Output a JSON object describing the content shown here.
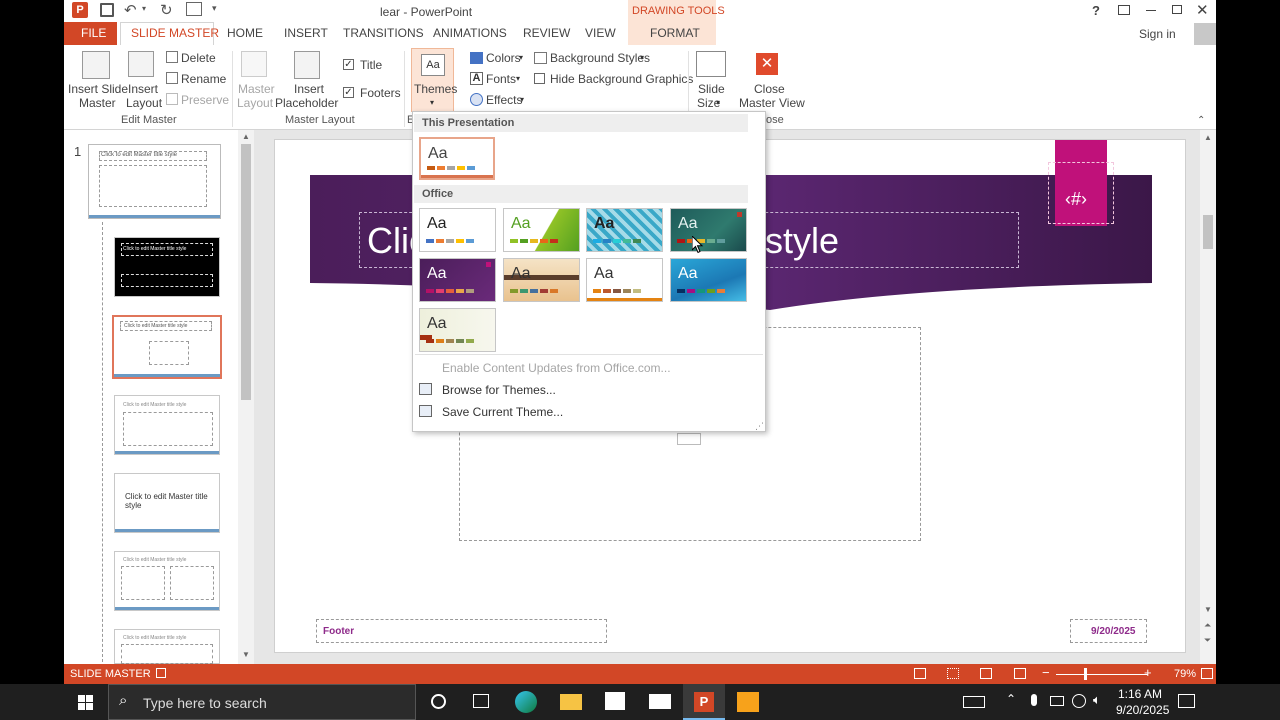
{
  "window": {
    "title": "lear - PowerPoint",
    "context_group": "DRAWING TOOLS",
    "help": "?",
    "signin": "Sign in"
  },
  "tabs": [
    "FILE",
    "SLIDE MASTER",
    "HOME",
    "INSERT",
    "TRANSITIONS",
    "ANIMATIONS",
    "REVIEW",
    "VIEW",
    "FORMAT"
  ],
  "ribbon": {
    "insert_slide_master": "Insert Slide Master",
    "insert_slide_master_l1": "Insert Slide",
    "insert_slide_master_l2": "Master",
    "insert_layout_l1": "Insert",
    "insert_layout_l2": "Layout",
    "delete": "Delete",
    "rename": "Rename",
    "preserve": "Preserve",
    "group_edit_master": "Edit Master",
    "master_layout_l1": "Master",
    "master_layout_l2": "Layout",
    "insert_placeholder_l1": "Insert",
    "insert_placeholder_l2": "Placeholder",
    "title_chk": "Title",
    "footers_chk": "Footers",
    "group_master_layout": "Master Layout",
    "themes": "Themes",
    "colors": "Colors",
    "fonts": "Fonts",
    "effects": "Effects",
    "background_styles": "Background Styles",
    "hide_bg": "Hide Background Graphics",
    "slide_size_l1": "Slide",
    "slide_size_l2": "Size",
    "close_master_l1": "Close",
    "close_master_l2": "Master View",
    "group_close_partial": "ose",
    "group_e_partial": "E"
  },
  "gallery": {
    "section_this": "This Presentation",
    "section_office": "Office",
    "aa": "Aa",
    "enable_updates": "Enable Content Updates from Office.com...",
    "browse": "Browse for Themes...",
    "save": "Save Current Theme..."
  },
  "thumbs": {
    "slide_number": "1",
    "master_title": "Click to edit Master title style",
    "layout_title": "Click to edit Master title style",
    "big_title": "Click to edit Master title style"
  },
  "slide": {
    "title_left": "Clic",
    "title_right": "style",
    "number_tag": "‹#›",
    "footer": "Footer",
    "date": "9/20/2025"
  },
  "status": {
    "mode": "SLIDE MASTER",
    "zoom": "79%"
  },
  "taskbar": {
    "search_placeholder": "Type here to search",
    "time": "1:16 AM",
    "date": "9/20/2025"
  },
  "colors": {
    "accent": "#d24726",
    "slide_purple": "#4b1e5a",
    "magenta": "#c0117a"
  }
}
